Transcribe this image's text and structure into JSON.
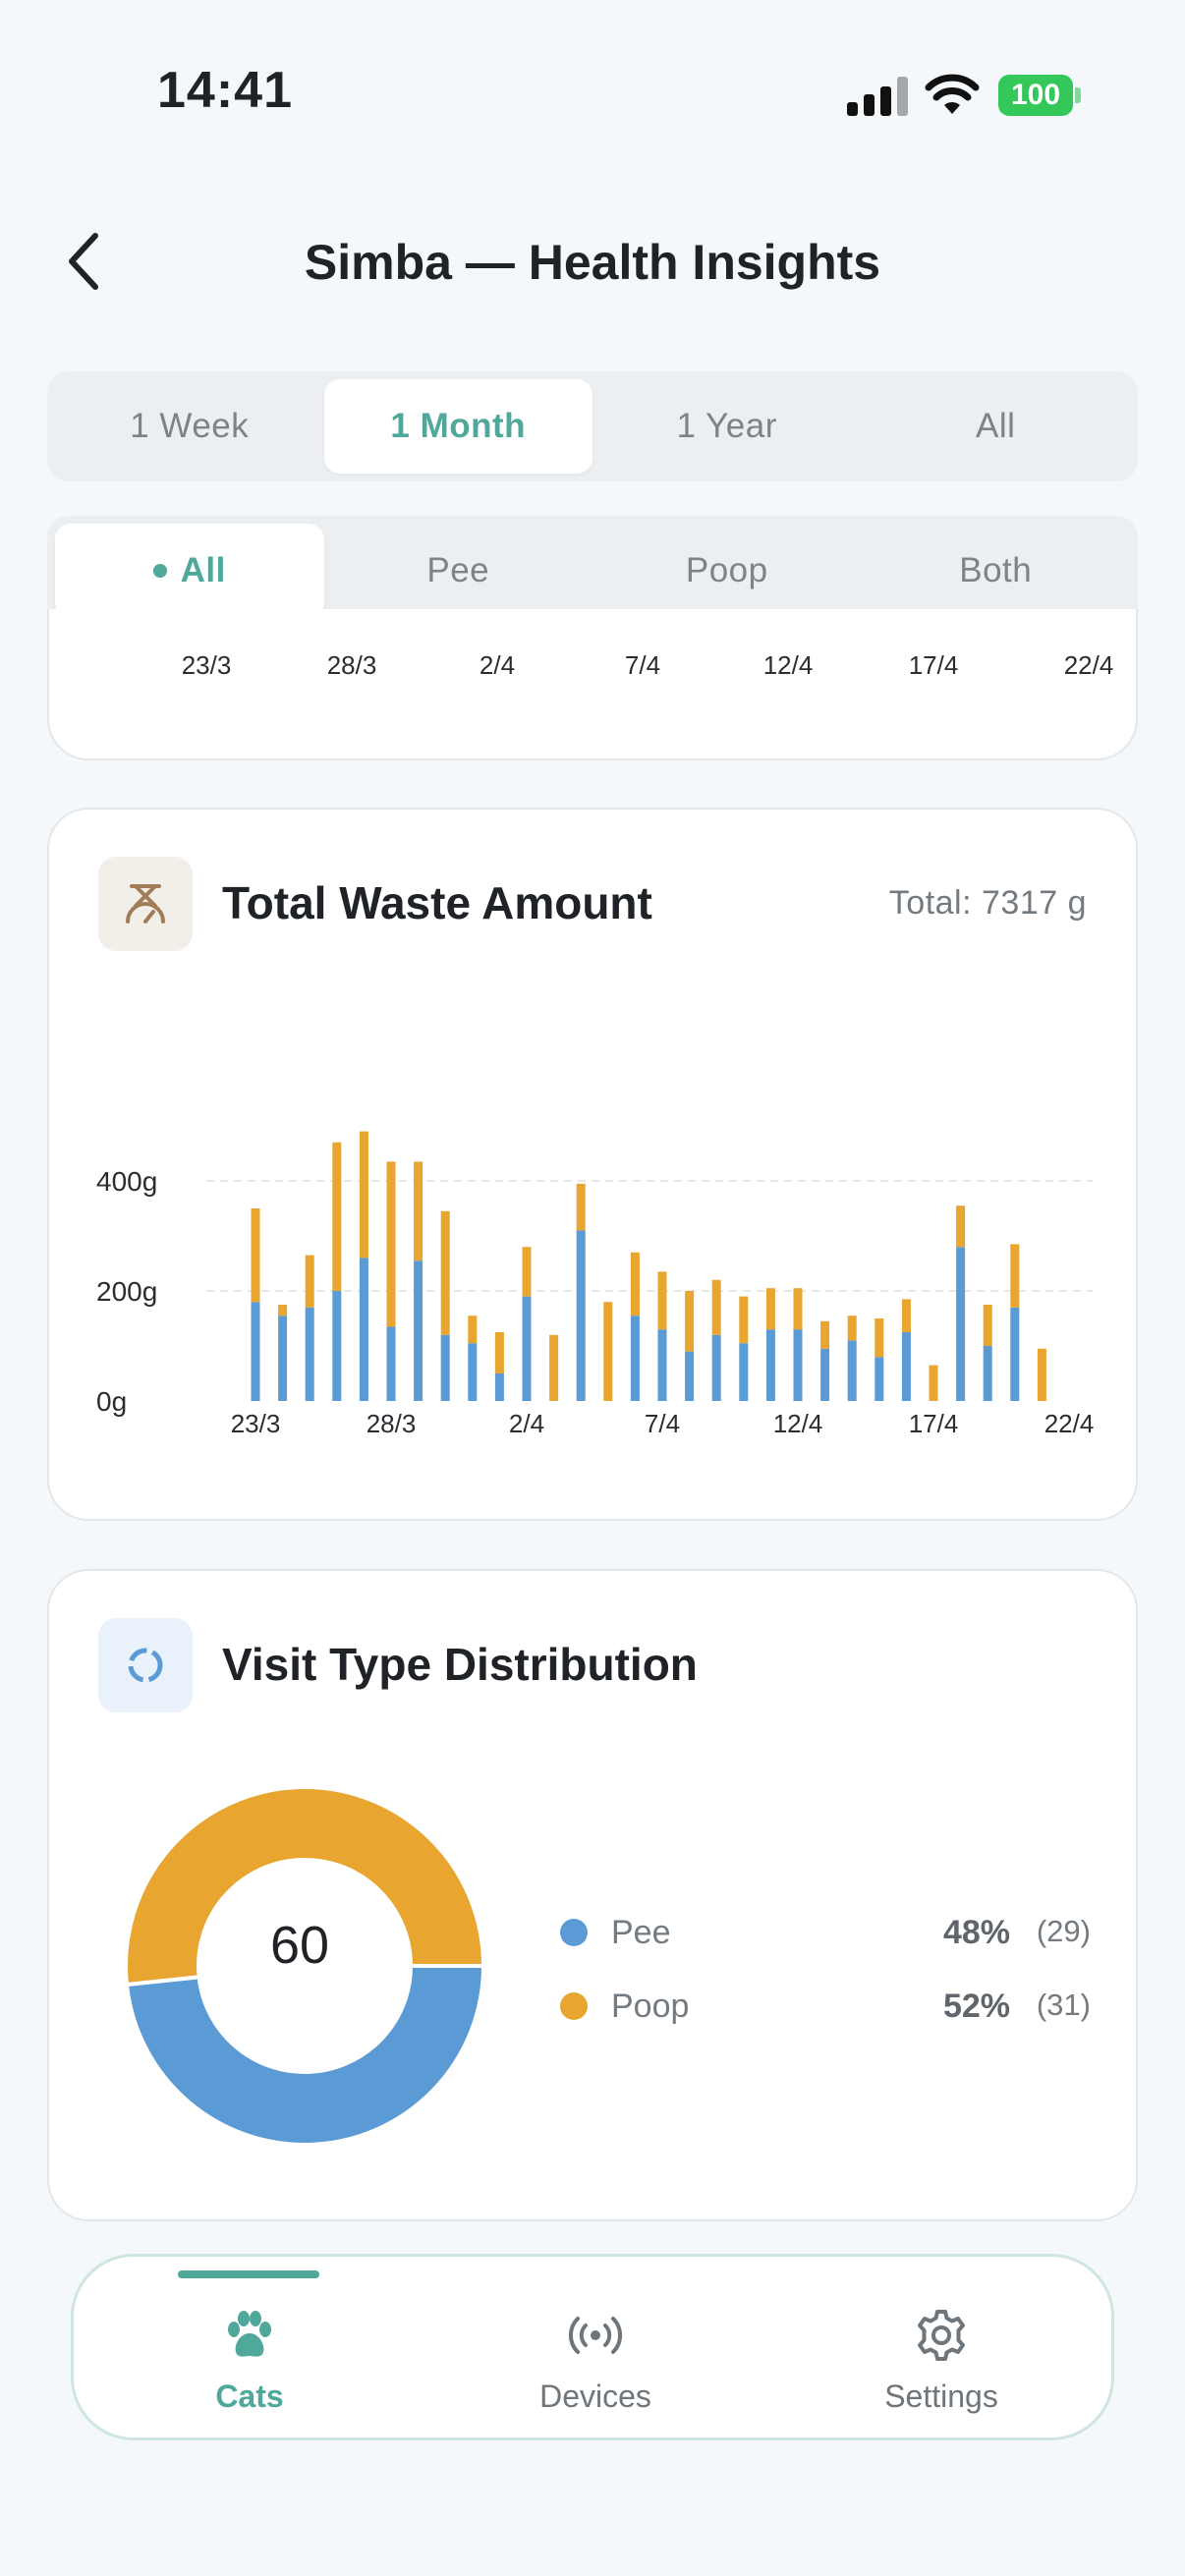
{
  "status_bar": {
    "time": "14:41",
    "battery": "100"
  },
  "header": {
    "title": "Simba — Health Insights"
  },
  "period_tabs": [
    {
      "label": "1 Week",
      "active": false
    },
    {
      "label": "1 Month",
      "active": true
    },
    {
      "label": "1 Year",
      "active": false
    },
    {
      "label": "All",
      "active": false
    }
  ],
  "type_tabs": [
    {
      "label": "All",
      "active": true
    },
    {
      "label": "Pee",
      "active": false
    },
    {
      "label": "Poop",
      "active": false
    },
    {
      "label": "Both",
      "active": false
    }
  ],
  "previous_chart_x_labels": [
    "23/3",
    "28/3",
    "2/4",
    "7/4",
    "12/4",
    "17/4",
    "22/4"
  ],
  "waste_card": {
    "title": "Total Waste Amount",
    "total": "Total: 7317 g"
  },
  "distribution_card": {
    "title": "Visit Type Distribution",
    "center_value": "60"
  },
  "legend": [
    {
      "name": "Pee",
      "pct": "48%",
      "count": "(29)"
    },
    {
      "name": "Poop",
      "pct": "52%",
      "count": "(31)"
    }
  ],
  "colors": {
    "accent": "#4fa89a",
    "pee": "#5b9bd5",
    "poop": "#e8a530"
  },
  "tabbar": [
    {
      "label": "Cats",
      "icon": "paw-icon",
      "active": true
    },
    {
      "label": "Devices",
      "icon": "broadcast-icon",
      "active": false
    },
    {
      "label": "Settings",
      "icon": "gear-icon",
      "active": false
    }
  ],
  "chart_data": [
    {
      "type": "bar",
      "stacked": true,
      "ylim": [
        0,
        500
      ],
      "yticks": [
        "0g",
        "200g",
        "400g"
      ],
      "ytick_values": [
        0,
        200,
        400
      ],
      "grid": true,
      "x_tick_labels": [
        "23/3",
        "28/3",
        "2/4",
        "7/4",
        "12/4",
        "17/4",
        "22/4"
      ],
      "categories": [
        "23/3",
        "24/3",
        "25/3",
        "26/3",
        "27/3",
        "28/3",
        "29/3",
        "30/3",
        "31/3",
        "1/4",
        "2/4",
        "3/4",
        "4/4",
        "5/4",
        "6/4",
        "7/4",
        "8/4",
        "9/4",
        "10/4",
        "11/4",
        "12/4",
        "13/4",
        "14/4",
        "15/4",
        "16/4",
        "17/4",
        "18/4",
        "19/4",
        "20/4",
        "21/4",
        "22/4"
      ],
      "series": [
        {
          "name": "Pee",
          "values": [
            180,
            155,
            170,
            200,
            260,
            135,
            255,
            120,
            105,
            50,
            190,
            0,
            310,
            0,
            155,
            130,
            90,
            120,
            105,
            130,
            130,
            95,
            110,
            80,
            125,
            0,
            280,
            100,
            170,
            0,
            0
          ]
        },
        {
          "name": "Poop",
          "values": [
            170,
            20,
            95,
            270,
            230,
            300,
            180,
            225,
            50,
            75,
            90,
            120,
            85,
            180,
            115,
            105,
            110,
            100,
            85,
            75,
            75,
            50,
            45,
            70,
            60,
            65,
            75,
            75,
            115,
            95,
            0
          ]
        }
      ]
    },
    {
      "type": "pie",
      "donut": true,
      "categories": [
        "Pee",
        "Poop"
      ],
      "values": [
        29,
        31
      ],
      "center_label": "60"
    }
  ]
}
